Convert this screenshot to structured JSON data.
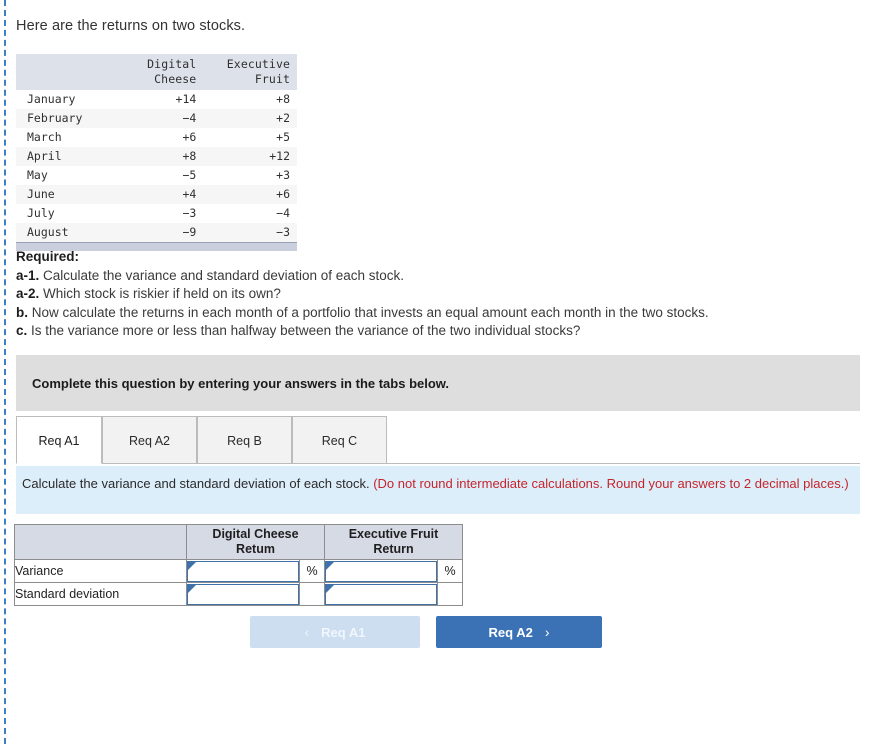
{
  "intro": {
    "text": "Here are the returns on two stocks."
  },
  "returns_table": {
    "columns": [
      "",
      "Digital Cheese",
      "Executive Fruit"
    ],
    "header_lines": [
      [
        "",
        ""
      ],
      [
        "Digital",
        "Cheese"
      ],
      [
        "Executive",
        "Fruit"
      ]
    ],
    "rows": [
      {
        "month": "January",
        "digital_cheese": "+14",
        "executive_fruit": "+8"
      },
      {
        "month": "February",
        "digital_cheese": "−4",
        "executive_fruit": "+2"
      },
      {
        "month": "March",
        "digital_cheese": "+6",
        "executive_fruit": "+5"
      },
      {
        "month": "April",
        "digital_cheese": "+8",
        "executive_fruit": "+12"
      },
      {
        "month": "May",
        "digital_cheese": "−5",
        "executive_fruit": "+3"
      },
      {
        "month": "June",
        "digital_cheese": "+4",
        "executive_fruit": "+6"
      },
      {
        "month": "July",
        "digital_cheese": "−3",
        "executive_fruit": "−4"
      },
      {
        "month": "August",
        "digital_cheese": "−9",
        "executive_fruit": "−3"
      }
    ]
  },
  "required": {
    "heading": "Required:",
    "items": [
      {
        "label": "a-1.",
        "text": "Calculate the variance and standard deviation of each stock."
      },
      {
        "label": "a-2.",
        "text": "Which stock is riskier if held on its own?"
      },
      {
        "label": "b.",
        "text": "Now calculate the returns in each month of a portfolio that invests an equal amount each month in the two stocks."
      },
      {
        "label": "c.",
        "text": "Is the variance more or less than halfway between the variance of the two individual stocks?"
      }
    ]
  },
  "complete_bar": {
    "text": "Complete this question by entering your answers in the tabs below."
  },
  "tabs": [
    {
      "label": "Req A1",
      "active": true
    },
    {
      "label": "Req A2",
      "active": false
    },
    {
      "label": "Req B",
      "active": false
    },
    {
      "label": "Req C",
      "active": false
    }
  ],
  "banner": {
    "main": "Calculate the variance and standard deviation of each stock. ",
    "note": "(Do not round intermediate calculations. Round your answers to 2 decimal places.)"
  },
  "answer_table": {
    "corner_label": "",
    "col_headers": [
      {
        "line1": "Digital Cheese",
        "line2": "Retum"
      },
      {
        "line1": "Executive Fruit",
        "line2": "Return"
      }
    ],
    "percent_symbol": "%",
    "rows": [
      {
        "label": "Variance",
        "digital_cheese": "",
        "executive_fruit": "",
        "show_percent": true
      },
      {
        "label": "Standard deviation",
        "digital_cheese": "",
        "executive_fruit": "",
        "show_percent": false
      }
    ]
  },
  "nav": {
    "prev_label": "Req A1",
    "prev_chevron": "‹",
    "next_label": "Req A2",
    "next_chevron": "›"
  },
  "colors": {
    "accent_blue": "#3a72b5",
    "prev_button": "#cddef0",
    "banner_blue": "#ddeefb",
    "note_red": "#c5242b",
    "table_header": "#dde1ea",
    "answer_header": "#d6dae5",
    "gray_bar": "#dededf",
    "rail_blue": "#3f7fc1"
  }
}
